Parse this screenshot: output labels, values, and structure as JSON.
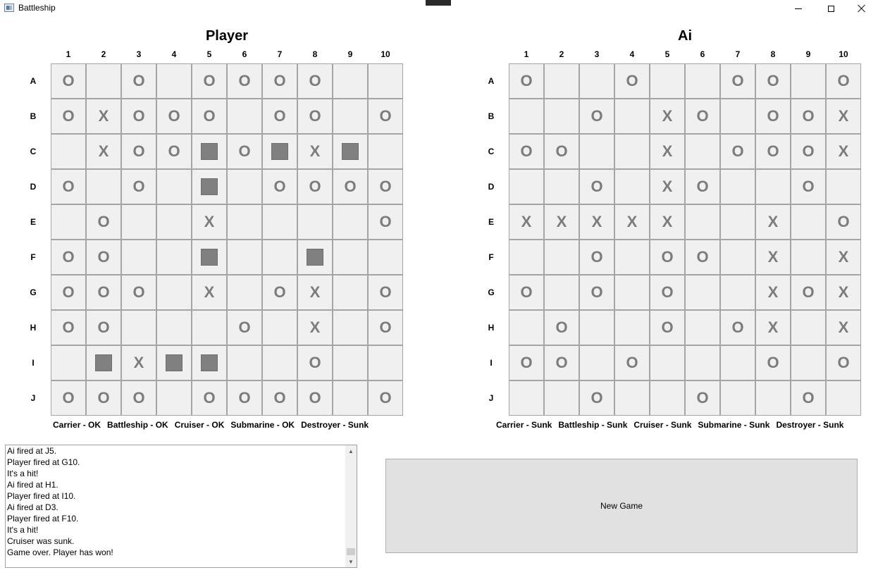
{
  "window": {
    "title": "Battleship",
    "icon": "battleship-app-icon"
  },
  "columns": [
    "1",
    "2",
    "3",
    "4",
    "5",
    "6",
    "7",
    "8",
    "9",
    "10"
  ],
  "rows": [
    "A",
    "B",
    "C",
    "D",
    "E",
    "F",
    "G",
    "H",
    "I",
    "J"
  ],
  "players": [
    {
      "title": "Player",
      "grid": [
        "O.O.OOOO..",
        "OXOOO.OO.O",
        ".XOOSOSXS.",
        "O.O.S.OOOO",
        ".O..X....O",
        "OO..S..S..",
        "OOO.X.OX.O",
        "OO...O.X.O",
        ".SXSS..O..",
        "OOO.OOOO.O"
      ],
      "ships": [
        "Carrier - OK",
        "Battleship - OK",
        "Cruiser - OK",
        "Submarine - OK",
        "Destroyer - Sunk"
      ]
    },
    {
      "title": "Ai",
      "grid": [
        "O..O..OO.O",
        "..O.XO.OOX",
        "OO..X.OOOX",
        "..O.XO..O.",
        "XXXXX..X.O",
        "..O.OO.X.X",
        "O.O.O..XOX",
        ".O..O.OX.X",
        "OO.O...O.O",
        "..O..O..O."
      ],
      "ships": [
        "Carrier - Sunk",
        "Battleship - Sunk",
        "Cruiser - Sunk",
        "Submarine - Sunk",
        "Destroyer - Sunk"
      ]
    }
  ],
  "log": [
    "Ai fired at J5.",
    "Player fired at G10.",
    "It's a hit!",
    "Ai fired at H1.",
    "Player fired at I10.",
    "Ai fired at D3.",
    "Player fired at F10.",
    "It's a hit!",
    "Cruiser was sunk.",
    "Game over. Player has won!"
  ],
  "new_game_label": "New Game",
  "colors": {
    "cell_bg": "#f0f0f0",
    "cell_border": "#a5a5a5",
    "mark": "#7c7c7c",
    "ship": "#808080",
    "button_bg": "#e1e1e1"
  }
}
